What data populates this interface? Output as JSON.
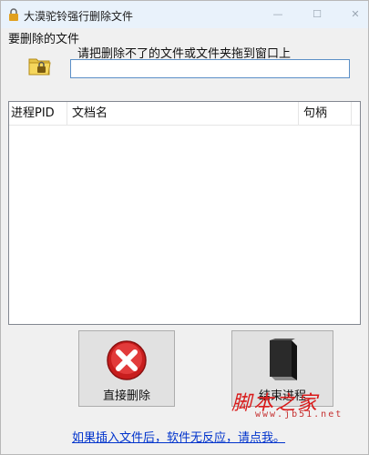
{
  "window": {
    "title": "大漠驼铃强行删除文件",
    "controls": {
      "minimize": "—",
      "maximize": "☐",
      "close": "✕"
    }
  },
  "target": {
    "group_label": "要删除的文件",
    "hint": "请把删除不了的文件或文件夹拖到窗口上",
    "path_value": ""
  },
  "list": {
    "columns": [
      "进程PID",
      "文档名",
      "句柄"
    ],
    "rows": []
  },
  "buttons": {
    "delete_label": "直接删除",
    "end_process_label": "结束进程"
  },
  "footer": {
    "help_link": "如果插入文件后，软件无反应，请点我。"
  },
  "watermark": {
    "text": "脚本之家",
    "url": "www.jb51.net"
  },
  "icons": {
    "title": "lock-icon",
    "folder": "folder-lock-icon",
    "delete": "delete-x-icon",
    "end": "end-process-icon"
  }
}
